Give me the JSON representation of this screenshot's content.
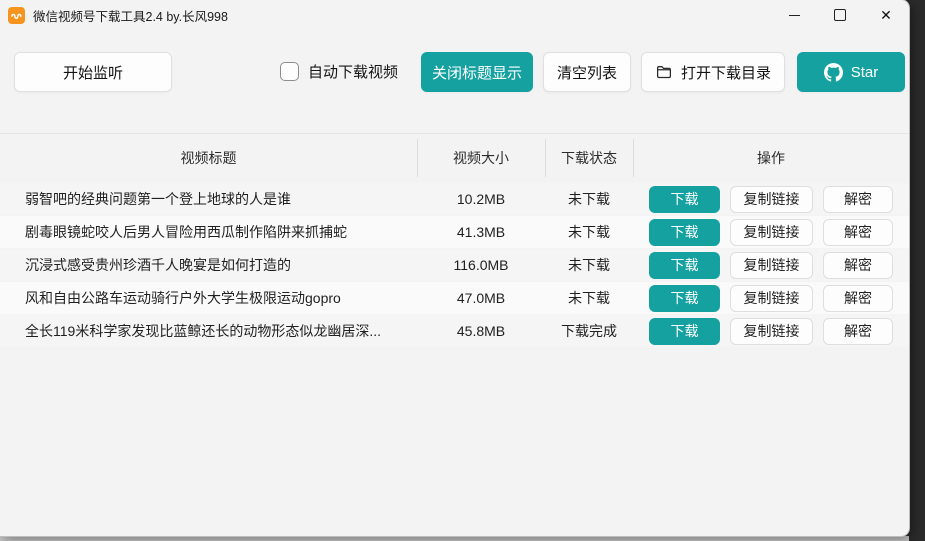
{
  "window": {
    "title": "微信视频号下载工具2.4 by.长风998",
    "controls": {
      "minimize": "minimize",
      "maximize": "maximize",
      "close": "✕"
    }
  },
  "icons": {
    "app": "wechat-channels-logo (white wave on orange square)",
    "folder": "folder-outline",
    "github": "github-mark",
    "checkbox": "rounded-square-unchecked"
  },
  "colors": {
    "accent_teal": "#14a1a0",
    "app_icon_orange": "#f7941d",
    "window_bg": "#f3f3f4"
  },
  "toolbar": {
    "start_listen": "开始监听",
    "auto_download_label": "自动下载视频",
    "auto_download_checked": false,
    "close_title_display": "关闭标题显示",
    "clear_list": "清空列表",
    "open_download_dir": "打开下载目录",
    "star": "Star"
  },
  "table": {
    "headers": [
      "视频标题",
      "视频大小",
      "下载状态",
      "操作"
    ],
    "row_actions": {
      "download": "下载",
      "copy_link": "复制链接",
      "decrypt": "解密"
    },
    "rows": [
      {
        "title": "弱智吧的经典问题第一个登上地球的人是谁",
        "size": "10.2MB",
        "status": "未下载"
      },
      {
        "title": "剧毒眼镜蛇咬人后男人冒险用西瓜制作陷阱来抓捕蛇",
        "size": "41.3MB",
        "status": "未下载"
      },
      {
        "title": "沉浸式感受贵州珍酒千人晚宴是如何打造的",
        "size": "116.0MB",
        "status": "未下载"
      },
      {
        "title": "风和自由公路车运动骑行户外大学生极限运动gopro",
        "size": "47.0MB",
        "status": "未下载"
      },
      {
        "title": "全长119米科学家发现比蓝鲸还长的动物形态似龙幽居深...",
        "size": "45.8MB",
        "status": "下载完成"
      }
    ]
  }
}
